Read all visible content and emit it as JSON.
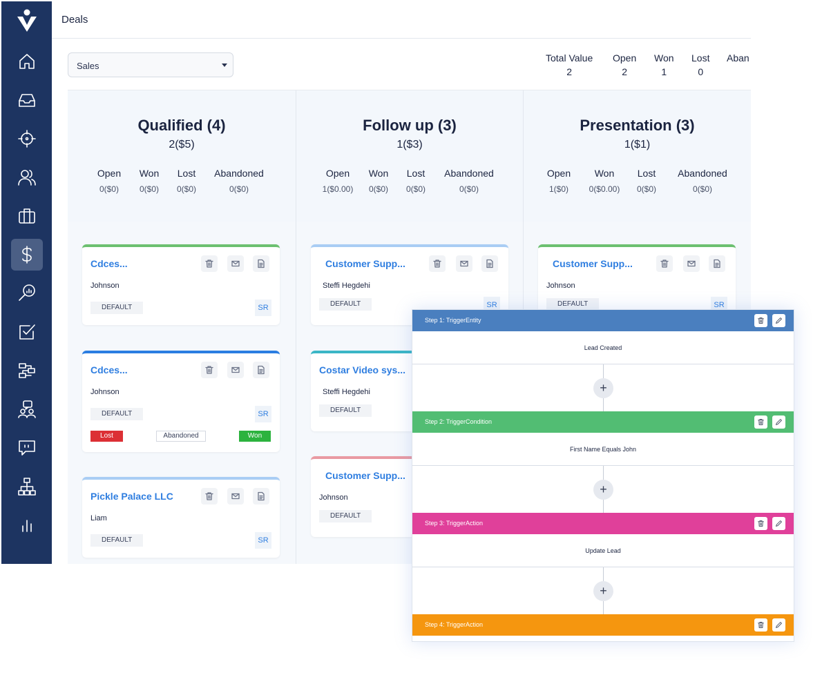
{
  "app": {
    "page_title": "Deals",
    "nav_items": [
      {
        "icon": "home-icon"
      },
      {
        "icon": "inbox-icon"
      },
      {
        "icon": "target-icon"
      },
      {
        "icon": "contacts-icon"
      },
      {
        "icon": "briefcase-icon"
      },
      {
        "icon": "dollar-icon",
        "active": true
      },
      {
        "icon": "search-analytics-icon"
      },
      {
        "icon": "tasks-icon"
      },
      {
        "icon": "workflow-icon"
      },
      {
        "icon": "support-icon"
      },
      {
        "icon": "chat-icon"
      },
      {
        "icon": "org-chart-icon"
      },
      {
        "icon": "reports-icon"
      }
    ]
  },
  "pipeline": {
    "selected": "Sales"
  },
  "summary": [
    {
      "label": "Total Value",
      "value": "2"
    },
    {
      "label": "Open",
      "value": "2"
    },
    {
      "label": "Won",
      "value": "1"
    },
    {
      "label": "Lost",
      "value": "0"
    },
    {
      "label": "Aban",
      "value": ""
    }
  ],
  "columns": [
    {
      "title": "Qualified (4)",
      "subtitle": "2($5)",
      "stats": [
        {
          "label": "Open",
          "value": "0($0)"
        },
        {
          "label": "Won",
          "value": "0($0)"
        },
        {
          "label": "Lost",
          "value": "0($0)"
        },
        {
          "label": "Abandoned",
          "value": "0($0)"
        }
      ],
      "cards": [
        {
          "name": "Cdces...",
          "contact": "Johnson",
          "tag": "DEFAULT",
          "owner": "SR",
          "accent": "#6cc070"
        },
        {
          "name": "Cdces...",
          "contact": "Johnson",
          "tag": "DEFAULT",
          "owner": "SR",
          "accent": "#2a7de1",
          "lost": "Lost",
          "abandoned": "Abandoned",
          "won": "Won"
        },
        {
          "name": "Pickle Palace LLC",
          "contact": "Liam",
          "tag": "DEFAULT",
          "owner": "SR",
          "accent": "#a9cdf4"
        }
      ]
    },
    {
      "title": "Follow up (3)",
      "subtitle": "1($3)",
      "stats": [
        {
          "label": "Open",
          "value": "1($0.00)"
        },
        {
          "label": "Won",
          "value": "0($0)"
        },
        {
          "label": "Lost",
          "value": "0($0)"
        },
        {
          "label": "Abandoned",
          "value": "0($0)"
        }
      ],
      "cards": [
        {
          "name": "Customer Supp...",
          "contact": "Steffi Hegdehi",
          "tag": "DEFAULT",
          "owner": "SR",
          "accent": "#a9cdf4"
        },
        {
          "name": "Costar Video sys...",
          "contact": "Steffi Hegdehi",
          "tag": "DEFAULT",
          "owner": "",
          "accent": "#3bb6c6"
        },
        {
          "name": "Customer Supp...",
          "contact": "Johnson",
          "tag": "DEFAULT",
          "owner": "",
          "accent": "#e99aa2"
        }
      ]
    },
    {
      "title": "Presentation (3)",
      "subtitle": "1($1)",
      "stats": [
        {
          "label": "Open",
          "value": "1($0)"
        },
        {
          "label": "Won",
          "value": "0($0.00)"
        },
        {
          "label": "Lost",
          "value": "0($0)"
        },
        {
          "label": "Abandoned",
          "value": "0($0)"
        }
      ],
      "cards": [
        {
          "name": "Customer Supp...",
          "contact": "Johnson",
          "tag": "DEFAULT",
          "owner": "SR",
          "accent": "#6cc070"
        }
      ]
    }
  ],
  "workflow": {
    "steps": [
      {
        "header": "Step 1: TriggerEntity",
        "body": "Lead Created",
        "color": "#4a7fbf"
      },
      {
        "header": "Step 2: TriggerCondition",
        "body": "First Name Equals John",
        "color": "#52bd73"
      },
      {
        "header": "Step 3: TriggerAction",
        "body": "Update Lead",
        "color": "#e0409a"
      },
      {
        "header": "Step 4: TriggerAction",
        "body": "",
        "color": "#f5960f"
      }
    ],
    "add_symbol": "+"
  },
  "colors": {
    "sidebar": "#1d3461",
    "link": "#2f7ee0",
    "lost": "#dc3035",
    "won": "#2cb33e"
  }
}
